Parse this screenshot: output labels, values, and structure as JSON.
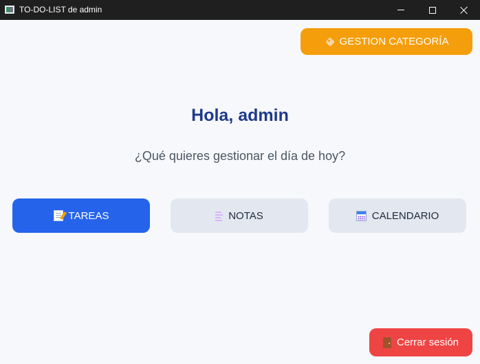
{
  "window": {
    "title": "TO-DO-LIST de admin",
    "icon": "app-icon"
  },
  "header": {
    "categories_button": {
      "label": "GESTION CATEGORÍA",
      "icon": "tag-icon",
      "color": "#f59e0b"
    }
  },
  "main": {
    "greeting": "Hola, admin",
    "question": "¿Qué quieres gestionar el día de hoy?",
    "options": [
      {
        "label": "TAREAS",
        "icon": "memo-icon",
        "color": "#2563eb"
      },
      {
        "label": "NOTAS",
        "icon": "notes-icon",
        "color": "#e3e8f0"
      },
      {
        "label": "CALENDARIO",
        "icon": "calendar-icon",
        "color": "#e3e8f0"
      }
    ]
  },
  "footer": {
    "logout_button": {
      "label": "Cerrar sesión",
      "icon": "door-icon",
      "color": "#ef4444"
    }
  },
  "colors": {
    "background": "#f7f8fb",
    "greeting_text": "#1e3a8a",
    "titlebar": "#1f1f1f"
  }
}
